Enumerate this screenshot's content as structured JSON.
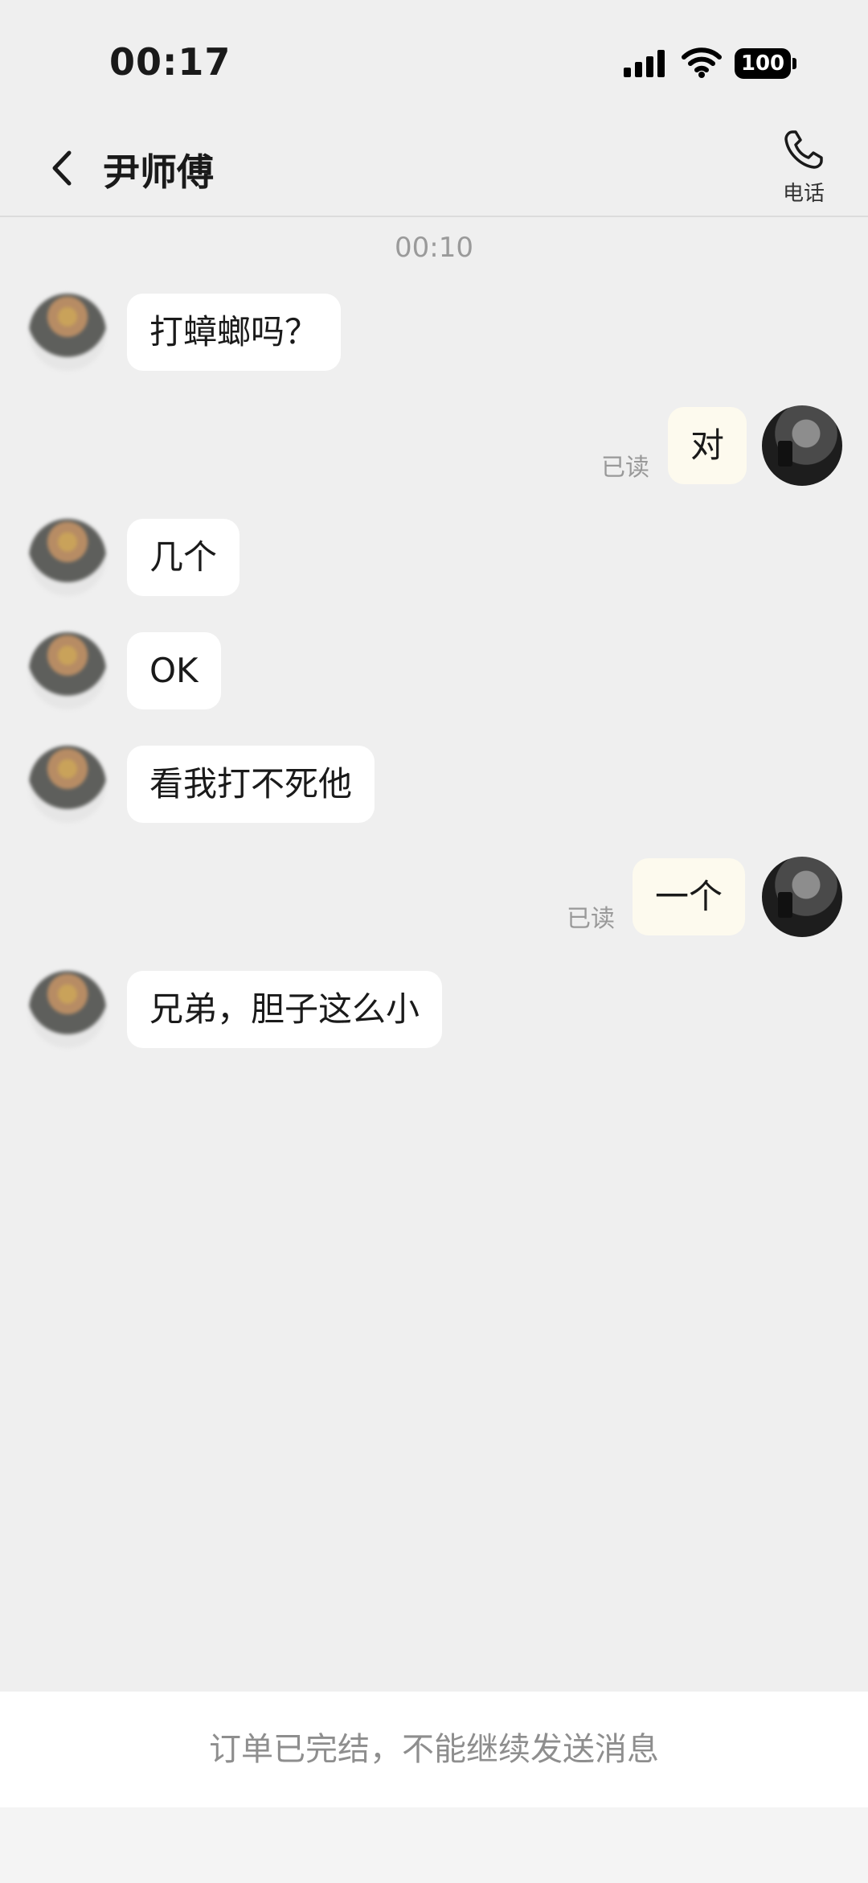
{
  "status_bar": {
    "time": "00:17",
    "battery": "100"
  },
  "header": {
    "title": "尹师傅",
    "phone_label": "电话"
  },
  "timestamp": "00:10",
  "messages": [
    {
      "sender": "other",
      "text": "打蟑螂吗？"
    },
    {
      "sender": "self",
      "text": "对",
      "status": "已读"
    },
    {
      "sender": "other",
      "text": "几个"
    },
    {
      "sender": "other",
      "text": "OK"
    },
    {
      "sender": "other",
      "text": "看我打不死他"
    },
    {
      "sender": "self",
      "text": "一个",
      "status": "已读"
    },
    {
      "sender": "other",
      "text": "兄弟，胆子这么小"
    }
  ],
  "footer": {
    "notice": "订单已完结，不能继续发送消息"
  }
}
